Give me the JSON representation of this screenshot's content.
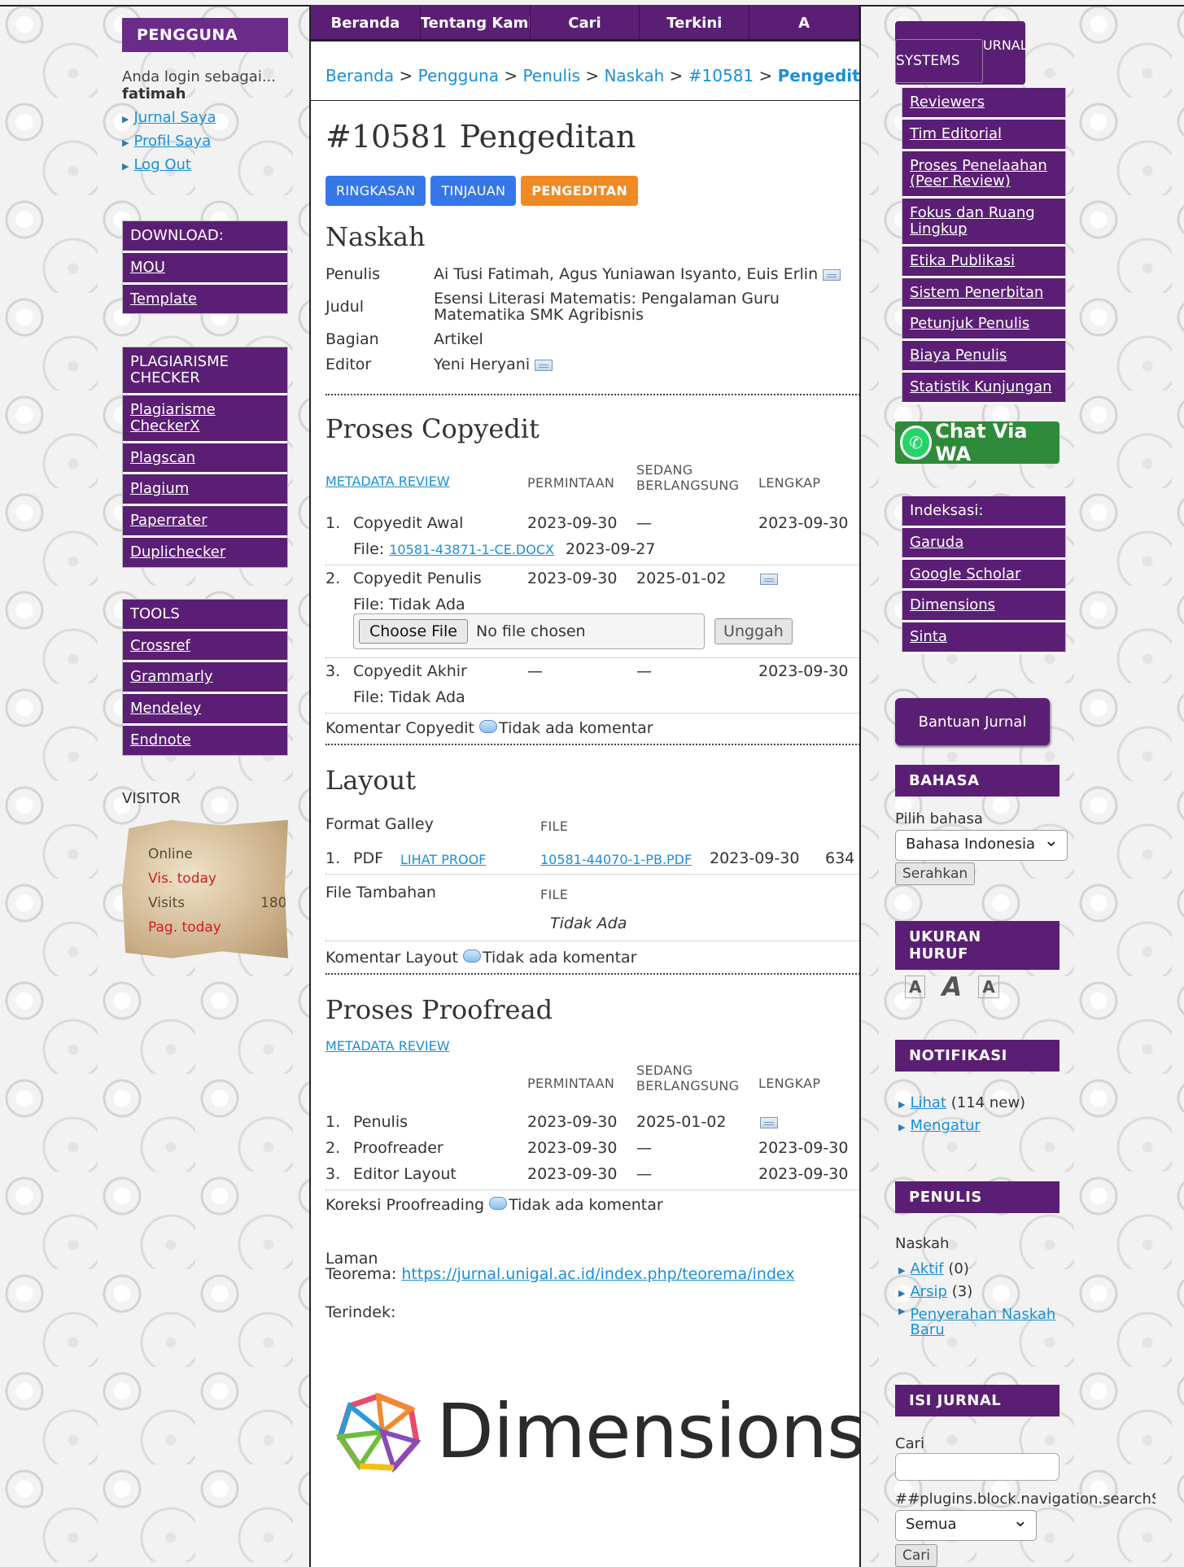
{
  "left": {
    "user_header": "PENGGUNA",
    "login_label": "Anda login sebagai...",
    "login_user": "fatimah",
    "user_links": [
      "Jurnal Saya",
      "Profil Saya",
      "Log Out"
    ],
    "download_menu": [
      "DOWNLOAD:",
      "MOU",
      "Template"
    ],
    "plagiarism_menu": [
      "PLAGIARISME CHECKER",
      "Plagiarisme CheckerX",
      "Plagscan",
      "Plagium",
      "Paperrater",
      "Duplichecker"
    ],
    "tools_menu": [
      "TOOLS",
      "Crossref",
      "Grammarly",
      "Mendeley",
      "Endnote"
    ],
    "visitor_title": "VISITOR",
    "visitor_rows": [
      "Online",
      "Vis. today",
      "Visits",
      "Pag. today"
    ],
    "visitor_count": "180"
  },
  "nav": {
    "tabs": [
      "Beranda",
      "Tentang Kami",
      "Cari",
      "Terkini",
      "A"
    ]
  },
  "breadcrumb": {
    "items": [
      "Beranda",
      "Pengguna",
      "Penulis",
      "Naskah",
      "#10581"
    ],
    "current": "Pengeditan",
    "sep": ">"
  },
  "page": {
    "title": "#10581 Pengeditan",
    "tabs": [
      "RINGKASAN",
      "TINJAUAN",
      "PENGEDITAN"
    ]
  },
  "naskah": {
    "heading": "Naskah",
    "rows": [
      {
        "k": "Penulis",
        "v": "Ai Tusi Fatimah, Agus Yuniawan Isyanto, Euis Erlin"
      },
      {
        "k": "Judul",
        "v": "Esensi Literasi Matematis: Pengalaman Guru Matematika SMK Agribisnis"
      },
      {
        "k": "Bagian",
        "v": "Artikel"
      },
      {
        "k": "Editor",
        "v": "Yeni Heryani"
      }
    ]
  },
  "copyedit": {
    "heading": "Proses Copyedit",
    "metadata_link": "METADATA REVIEW",
    "col_request": "PERMINTAAN",
    "col_progress_1": "SEDANG",
    "col_progress_2": "BERLANGSUNG",
    "col_complete": "LENGKAP",
    "rows": [
      {
        "num": "1.",
        "name": "Copyedit Awal",
        "req": "2023-09-30",
        "prog": "—",
        "done": "2023-09-30"
      },
      {
        "num": "2.",
        "name": "Copyedit Penulis",
        "req": "2023-09-30",
        "prog": "2025-01-02",
        "done": ""
      },
      {
        "num": "3.",
        "name": "Copyedit Akhir",
        "req": "—",
        "prog": "—",
        "done": "2023-09-30"
      }
    ],
    "file1_label": "File:",
    "file1_link": "10581-43871-1-CE.DOCX",
    "file1_date": "2023-09-27",
    "file_none": "File: Tidak Ada",
    "choose_file": "Choose File",
    "no_file": "No file chosen",
    "upload": "Unggah",
    "comment_label": "Komentar Copyedit",
    "comment_none": "Tidak ada komentar"
  },
  "layout": {
    "heading": "Layout",
    "galley_label": "Format Galley",
    "file_col": "FILE",
    "row_num": "1.",
    "row_fmt": "PDF",
    "row_proof": "LIHAT PROOF",
    "row_file": "10581-44070-1-PB.PDF",
    "row_date": "2023-09-30",
    "row_count": "634",
    "extra_label": "File Tambahan",
    "extra_none": "Tidak Ada",
    "comment_label": "Komentar Layout",
    "comment_none": "Tidak ada komentar"
  },
  "proofread": {
    "heading": "Proses Proofread",
    "metadata_link": "METADATA REVIEW",
    "rows": [
      {
        "num": "1.",
        "name": "Penulis",
        "req": "2023-09-30",
        "prog": "2025-01-02",
        "done": ""
      },
      {
        "num": "2.",
        "name": "Proofreader",
        "req": "2023-09-30",
        "prog": "—",
        "done": "2023-09-30"
      },
      {
        "num": "3.",
        "name": "Editor Layout",
        "req": "2023-09-30",
        "prog": "—",
        "done": "2023-09-30"
      }
    ],
    "comment_label": "Koreksi Proofreading",
    "comment_none": "Tidak ada komentar"
  },
  "footer": {
    "laman_label": "Laman",
    "teorema_label": "Teorema:",
    "teorema_url": "https://jurnal.unigal.ac.id/index.php/teorema/index",
    "terindek": "Terindek:",
    "logo_text": "Dimensions"
  },
  "right": {
    "jsys_top": "URNAL",
    "jsys_label": "SYSTEMS",
    "menu1": [
      "Reviewers",
      "Tim Editorial",
      "Proses Penelaahan (Peer Review)",
      "Fokus dan Ruang Lingkup",
      "Etika Publikasi",
      "Sistem Penerbitan",
      "Petunjuk Penulis",
      "Biaya Penulis",
      "Statistik Kunjungan"
    ],
    "wa": "Chat Via WA",
    "menu2": [
      "Indeksasi:",
      "Garuda",
      "Google Scholar",
      "Dimensions",
      "Sinta"
    ],
    "bantuan": "Bantuan Jurnal",
    "bahasa_head": "BAHASA",
    "bahasa_label": "Pilih bahasa",
    "bahasa_value": "Bahasa Indonesia",
    "submit": "Serahkan",
    "ukuran_head": "UKURAN HURUF",
    "notif_head": "NOTIFIKASI",
    "notif_view": "Lihat",
    "notif_count": "(114 new)",
    "notif_settings": "Mengatur",
    "penulis_head": "PENULIS",
    "penulis_label": "Naskah",
    "penulis_active": "Aktif",
    "penulis_active_count": "(0)",
    "penulis_archive": "Arsip",
    "penulis_archive_count": "(3)",
    "penulis_new": "Penyerahan Naskah Baru",
    "isi_head": "ISI JURNAL",
    "cari_label": "Cari",
    "scope_label": "##plugins.block.navigation.searchScope##",
    "scope_value": "Semua",
    "cari_btn": "Cari"
  }
}
